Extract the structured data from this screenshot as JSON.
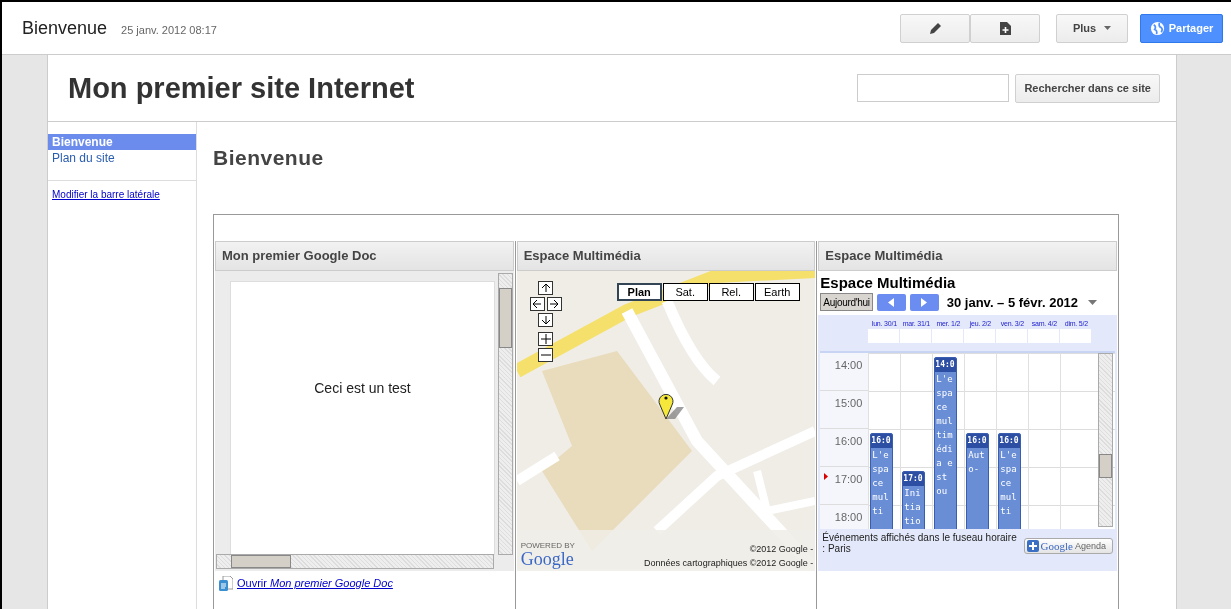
{
  "top_bar": {
    "title": "Bienvenue",
    "timestamp": "25 janv. 2012 08:17",
    "more_button": "Plus",
    "share_button": "Partager"
  },
  "site": {
    "title": "Mon premier site Internet",
    "search": {
      "button": "Rechercher dans ce site"
    }
  },
  "sidebar": {
    "items": [
      {
        "label": "Bienvenue",
        "selected": true
      },
      {
        "label": "Plan du site",
        "selected": false
      }
    ],
    "edit_link": "Modifier la barre latérale"
  },
  "page_title": "Bienvenue",
  "doc_gadget": {
    "title": "Mon premier Google Doc",
    "body": "Ceci est un test",
    "open_link": "Ouvrir *Mon premier Google Doc*"
  },
  "map_gadget": {
    "title": "Espace Multimédia",
    "map_types": [
      {
        "label": "Plan",
        "selected": true
      },
      {
        "label": "Sat.",
        "selected": false
      },
      {
        "label": "Rel.",
        "selected": false
      },
      {
        "label": "Earth",
        "selected": false
      }
    ],
    "powered_by": "POWERED BY",
    "logo": "Google",
    "copyright": "©2012 Google -",
    "map_data": "Données cartographiques ©2012 Google -"
  },
  "calendar_gadget": {
    "title": "Espace Multimédia",
    "calendar_title": "Espace Multimédia",
    "today_button": "Aujourd'hui",
    "range": "30 janv. – 5 févr. 2012",
    "hours": [
      "14:00",
      "15:00",
      "16:00",
      "17:00",
      "18:00"
    ],
    "days": [
      {
        "label": "lun. 30/1",
        "events": [
          {
            "kind": "h16",
            "time": "16:0",
            "text": "L'espace multi"
          }
        ]
      },
      {
        "label": "mar. 31/1",
        "events": [
          {
            "kind": "h17",
            "time": "17:0",
            "text": "Initiatio"
          }
        ]
      },
      {
        "label": "mer. 1/2",
        "events": [
          {
            "kind": "h14",
            "time": "14:0",
            "text": "L'espace multimédia est ou"
          }
        ]
      },
      {
        "label": "jeu. 2/2",
        "events": [
          {
            "kind": "h16",
            "time": "16:0",
            "text": "Auto-"
          }
        ]
      },
      {
        "label": "ven. 3/2",
        "events": [
          {
            "kind": "h16",
            "time": "16:0",
            "text": "L'espace multi"
          }
        ]
      },
      {
        "label": "sam. 4/2"
      },
      {
        "label": "dim. 5/2"
      }
    ],
    "timezone_note": "Événements affichés dans le fuseau horaire : Paris",
    "agenda_logo": "Google",
    "agenda_label": "Agenda"
  }
}
